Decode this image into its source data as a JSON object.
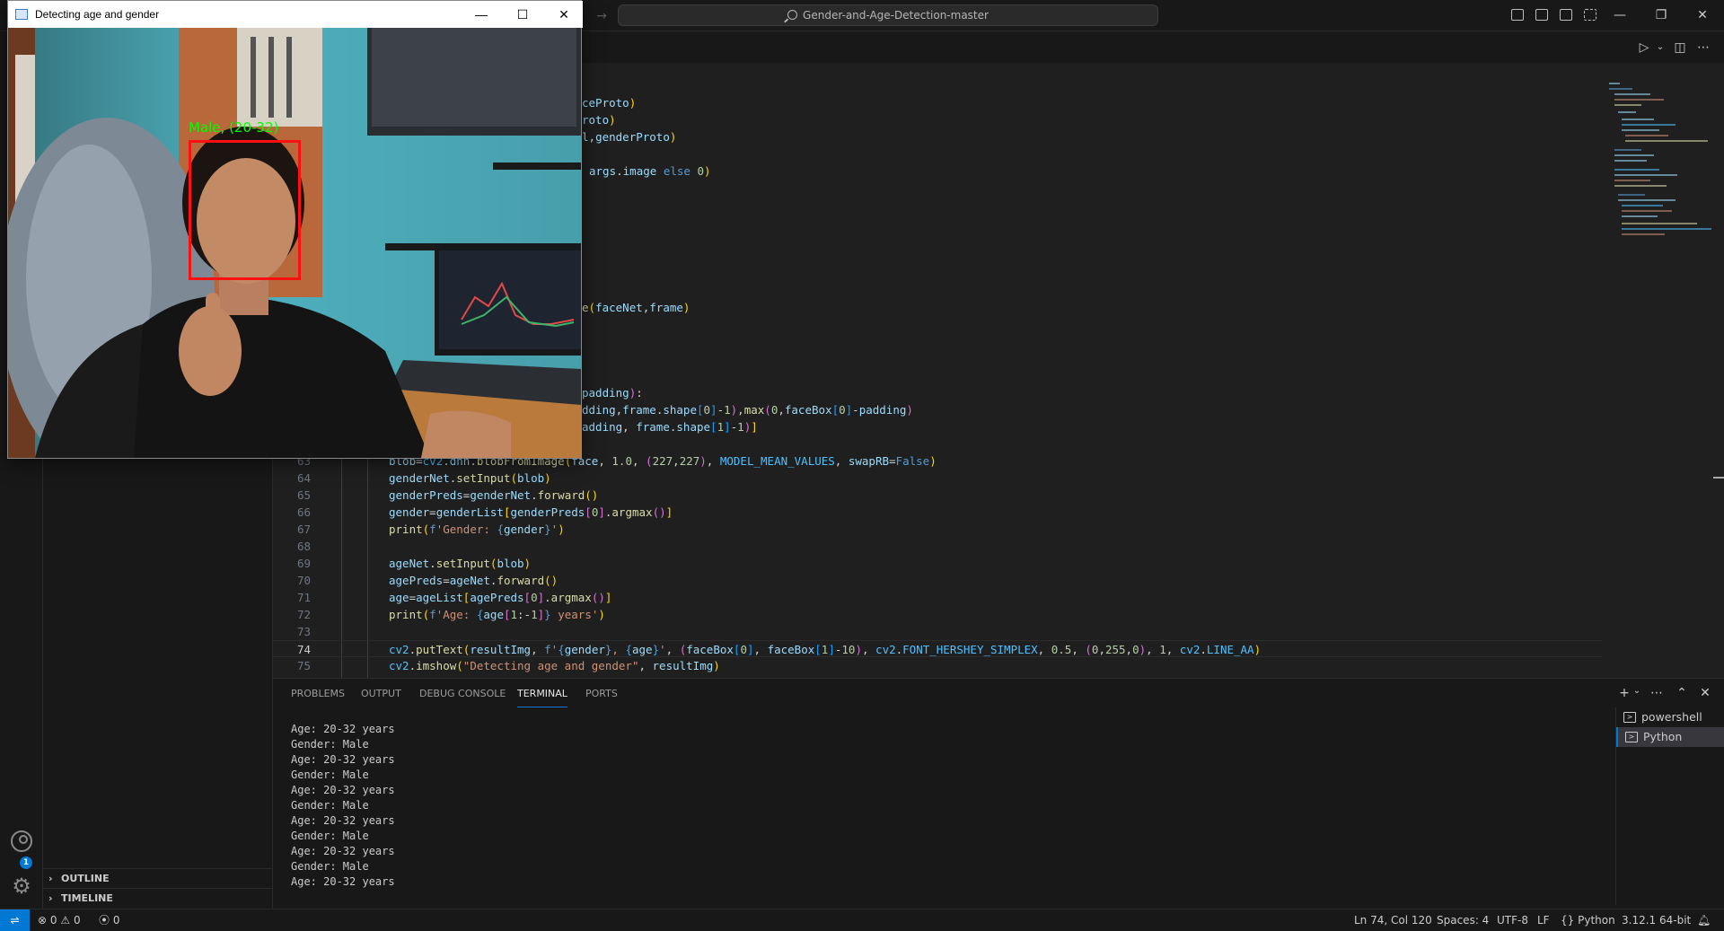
{
  "titlebar": {
    "search_text": "Gender-and-Age-Detection-master",
    "window_controls": [
      "minimize",
      "restore",
      "close"
    ]
  },
  "editor": {
    "visible_upper_fragments": [
      "ceProto)",
      "roto)",
      "l,genderProto)",
      "",
      "args.image else 0)",
      "e(faceNet,frame)",
      "padding):",
      "dding,frame.shape[0]-1),max(0,faceBox[0]-padding)",
      "adding, frame.shape[1]-1)]"
    ],
    "lines": [
      {
        "num": "63",
        "code": "blob=cv2.dnn.blobFromImage(face, 1.0, (227,227), MODEL_MEAN_VALUES, swapRB=False)"
      },
      {
        "num": "64",
        "code": "genderNet.setInput(blob)"
      },
      {
        "num": "65",
        "code": "genderPreds=genderNet.forward()"
      },
      {
        "num": "66",
        "code": "gender=genderList[genderPreds[0].argmax()]"
      },
      {
        "num": "67",
        "code": "print(f'Gender: {gender}')"
      },
      {
        "num": "68",
        "code": ""
      },
      {
        "num": "69",
        "code": "ageNet.setInput(blob)"
      },
      {
        "num": "70",
        "code": "agePreds=ageNet.forward()"
      },
      {
        "num": "71",
        "code": "age=ageList[agePreds[0].argmax()]"
      },
      {
        "num": "72",
        "code": "print(f'Age: {age[1:-1]} years')"
      },
      {
        "num": "73",
        "code": ""
      },
      {
        "num": "74",
        "code": "cv2.putText(resultImg, f'{gender}, {age}', (faceBox[0], faceBox[1]-10), cv2.FONT_HERSHEY_SIMPLEX, 0.5, (0,255,0), 1, cv2.LINE_AA)"
      },
      {
        "num": "75",
        "code": "cv2.imshow(\"Detecting age and gender\", resultImg)"
      }
    ],
    "active_line": "74"
  },
  "panel": {
    "tabs": [
      "PROBLEMS",
      "OUTPUT",
      "DEBUG CONSOLE",
      "TERMINAL",
      "PORTS"
    ],
    "active_tab": "TERMINAL",
    "terminal_output": "Age: 20-32 years\nGender: Male\nAge: 20-32 years\nGender: Male\nAge: 20-32 years\nGender: Male\nAge: 20-32 years\nGender: Male\nAge: 20-32 years\nGender: Male\nAge: 20-32 years",
    "terminals": [
      {
        "label": "powershell",
        "selected": false
      },
      {
        "label": "Python",
        "selected": true
      }
    ]
  },
  "sidebar": {
    "sections": [
      {
        "label": "OUTLINE"
      },
      {
        "label": "TIMELINE"
      }
    ]
  },
  "activitybar": {
    "settings_badge": "1"
  },
  "statusbar": {
    "errors": "0",
    "warnings": "0",
    "ports": "0",
    "cursor": "Ln 74, Col 120",
    "spaces": "Spaces: 4",
    "encoding": "UTF-8",
    "eol": "LF",
    "language": "Python",
    "interpreter": "3.12.1 64-bit"
  },
  "cv_window": {
    "title": "Detecting age and gender",
    "face_label": "Male, (20-32)"
  },
  "colors": {
    "accent": "#0078d4",
    "face_box": "#ff1010",
    "face_label": "#00ff00"
  }
}
